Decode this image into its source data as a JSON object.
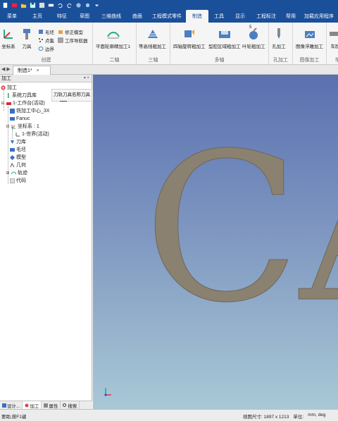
{
  "quick_access": {
    "icons": [
      "new-file-icon",
      "mail-icon",
      "open-icon",
      "save-icon",
      "save-as-icon",
      "print-icon",
      "undo-icon",
      "redo-icon",
      "globe-icon",
      "settings-icon",
      "dropdown-icon"
    ]
  },
  "menu": {
    "tabs": [
      "菜单",
      "主页",
      "特征",
      "草图",
      "三维曲线",
      "曲面",
      "工程模式零件",
      "制造",
      "工具",
      "显示",
      "工程标注",
      "帮用",
      "加载应用程序"
    ],
    "active": "制造"
  },
  "ribbon": {
    "create": {
      "label": "创建",
      "coord_label": "坐标系",
      "tool_label": "刀具",
      "blank_label": "毛坯",
      "points_label": "点集",
      "boundary_label": "边界",
      "correct_model_label": "修正模型",
      "process_nav_label": "工序导航器"
    },
    "two_axis": {
      "label": "二轴",
      "button": "平面轮廓精加工1"
    },
    "three_axis": {
      "label": "三轴",
      "button": "等高线粗加工"
    },
    "multi_axis": {
      "label": "多轴",
      "btn1": "四轴旋转粗加工",
      "btn2": "型腔区域粗加工",
      "btn3": "叶轮粗加工"
    },
    "hole": {
      "label": "孔加工",
      "button": "孔加工"
    },
    "image": {
      "label": "图像加工",
      "button": "图像浮雕加工"
    },
    "turning": {
      "label": "车",
      "button": "车削"
    },
    "number_badge": "5"
  },
  "doc_tab": {
    "title": "制造1*",
    "close": "×",
    "arrows": "◀ ▶"
  },
  "panel": {
    "title": "加工",
    "pin": "▾ ×",
    "tree": [
      {
        "label": "加工",
        "icon": "gear-icon"
      },
      {
        "label": "系统刀具库",
        "icon": "tool-library-icon"
      },
      {
        "label": "1-工作台(活动)",
        "icon": "workbench-icon"
      },
      {
        "label": "铣加工中心_3X",
        "icon": "machine-icon"
      },
      {
        "label": "Fanuc",
        "icon": "controller-icon"
      },
      {
        "label": "坐标系 : 1",
        "icon": "coordinate-icon"
      },
      {
        "label": "1-世界(活动)",
        "icon": "world-icon"
      },
      {
        "label": "刀库",
        "icon": "tool-magazine-icon"
      },
      {
        "label": "毛坯",
        "icon": "blank-icon"
      },
      {
        "label": "模型",
        "icon": "model-icon"
      },
      {
        "label": "几何",
        "icon": "geometry-icon"
      },
      {
        "label": "轨迹",
        "icon": "toolpath-icon"
      },
      {
        "label": "代码",
        "icon": "code-icon"
      }
    ],
    "tooltip": "刀轨刀具名称刀具"
  },
  "bottom_tabs": [
    "设计...",
    "加工",
    "属性",
    "搜索"
  ],
  "viewport": {
    "model_text": "CA",
    "axis_label": "Z X Y"
  },
  "status": {
    "left": "要助,按F1键",
    "viewport_size": "视图尺寸: 1897 x 1213",
    "units_label": "单位:",
    "units_value": "mm, deg"
  },
  "colors": {
    "title_bar": "#1a4f9a",
    "viewport_top": "#5a70b0",
    "viewport_bottom": "#a9c8d6",
    "model_fill": "#8a8170"
  }
}
